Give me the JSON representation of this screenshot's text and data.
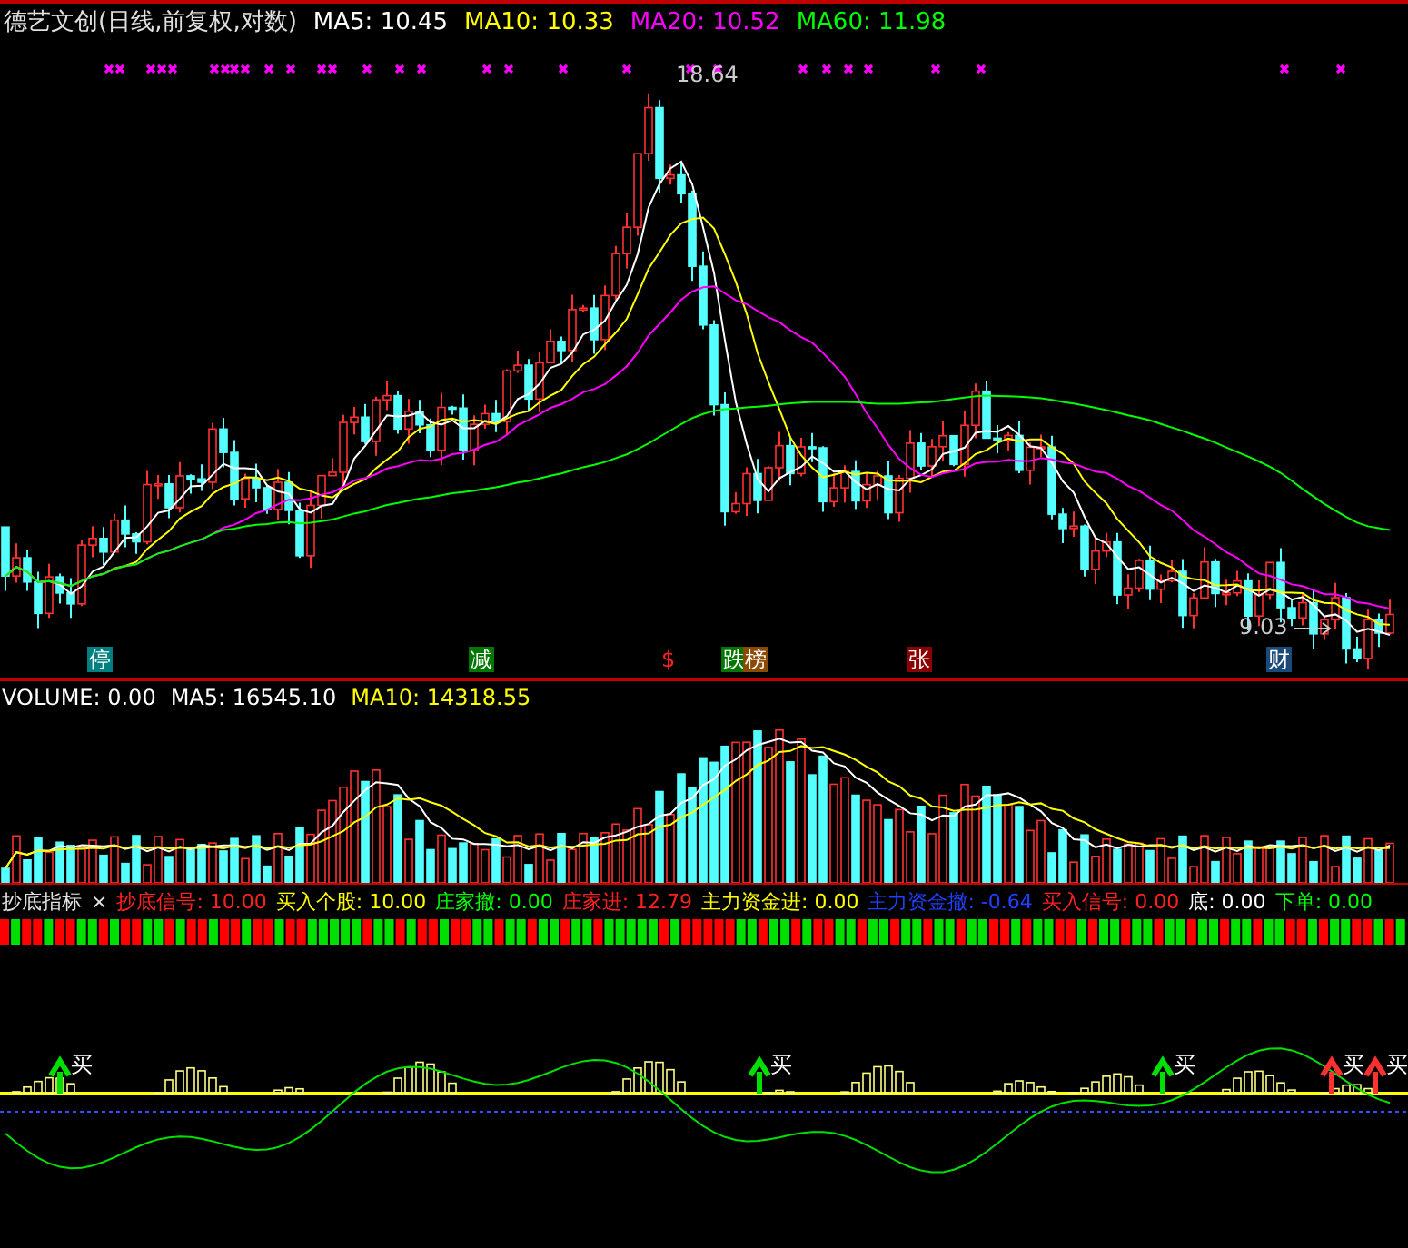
{
  "header": {
    "title": "德艺文创(日线,前复权,对数)",
    "legend": [
      {
        "text": "MA5: 10.45",
        "color": "#ffffff"
      },
      {
        "text": "MA10: 10.33",
        "color": "#ffff00"
      },
      {
        "text": "MA20: 10.52",
        "color": "#ff00ff"
      },
      {
        "text": "MA60: 11.98",
        "color": "#00ff00"
      }
    ]
  },
  "price_chart": {
    "high_label": "18.64",
    "low_label": "9.03",
    "tags": [
      {
        "text": "停",
        "color": "#008080"
      },
      {
        "text": "减",
        "color": "#007700"
      },
      {
        "text": "$",
        "color": "#000000"
      },
      {
        "text": "跌",
        "color": "#007700"
      },
      {
        "text": "榜",
        "color": "#8b4a00"
      },
      {
        "text": "张",
        "color": "#8b0000"
      },
      {
        "text": "财",
        "color": "#1a4a7a"
      }
    ]
  },
  "volume": {
    "legend": [
      {
        "text": "VOLUME: 0.00",
        "color": "#ffffff"
      },
      {
        "text": "MA5: 16545.10",
        "color": "#ffffff"
      },
      {
        "text": "MA10: 14318.55",
        "color": "#ffff00"
      }
    ]
  },
  "indicator": {
    "name": "抄底指标",
    "close": "×",
    "legend": [
      {
        "text": "抄底信号: 10.00",
        "color": "#ff2020"
      },
      {
        "text": "买入个股: 10.00",
        "color": "#ffff00"
      },
      {
        "text": "庄家撤: 0.00",
        "color": "#00ff00"
      },
      {
        "text": "庄家进: 12.79",
        "color": "#ff2020"
      },
      {
        "text": "主力资金进: 0.00",
        "color": "#ffff00"
      },
      {
        "text": "主力资金撤: -0.64",
        "color": "#2040ff"
      },
      {
        "text": "买入信号: 0.00",
        "color": "#ff2020"
      },
      {
        "text": "底: 0.00",
        "color": "#ffffff"
      },
      {
        "text": "下单: 0.00",
        "color": "#00ff00"
      }
    ],
    "buy_labels": [
      "买",
      "买",
      "买",
      "买",
      "买"
    ]
  }
}
